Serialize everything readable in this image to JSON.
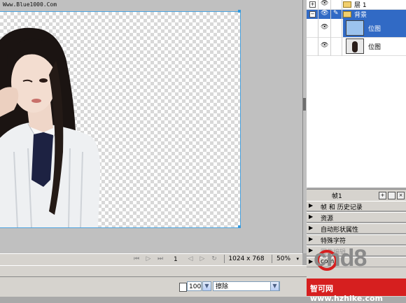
{
  "watermark_top": "Www.Blue1000.Com",
  "status": {
    "frame_number": "1",
    "dimensions": "1024 x 768",
    "zoom": "50%",
    "vcr_icons": [
      "first-frame-icon",
      "play-icon",
      "last-frame-icon",
      "prev-frame-icon",
      "next-frame-icon",
      "loop-icon"
    ]
  },
  "properties": {
    "opacity": "100",
    "blend_mode": "擦除"
  },
  "layers": {
    "rows": [
      {
        "name": "层 1"
      },
      {
        "name": "背景"
      },
      {
        "name": "位图"
      },
      {
        "name": "位图"
      }
    ]
  },
  "frames_bar": {
    "label": "帧1"
  },
  "panels": [
    {
      "label": "帧 和 历史记录"
    },
    {
      "label": "资源"
    },
    {
      "label": "自动形状属性"
    },
    {
      "label": "特殊字符"
    },
    {
      "label": "图像编辑"
    },
    {
      "label": "com"
    }
  ],
  "logo": {
    "text": "cnd8"
  },
  "site": {
    "text": "智可网 www.hzhike.com"
  },
  "colors": {
    "selection_blue": "#316ac5",
    "canvas_border": "#4aa3df",
    "logo_red": "#d61f1f"
  }
}
